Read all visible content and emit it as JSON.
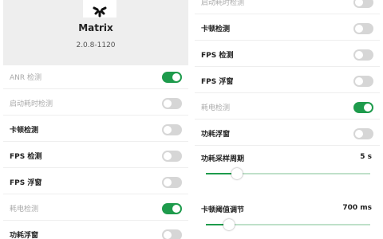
{
  "accent_color": "#1e9b4c",
  "app": {
    "name": "Matrix",
    "version": "2.0.8-1120",
    "logo_icon": "loading-spinner-icon"
  },
  "left_settings": [
    {
      "label": "ANR 检测",
      "enabled": false,
      "checked": true
    },
    {
      "label": "启动耗时检测",
      "enabled": false,
      "checked": false
    },
    {
      "label": "卡顿检测",
      "enabled": true,
      "checked": false
    },
    {
      "label": "FPS 检测",
      "enabled": true,
      "checked": false
    },
    {
      "label": "FPS 浮窗",
      "enabled": true,
      "checked": false
    },
    {
      "label": "耗电检测",
      "enabled": false,
      "checked": true
    },
    {
      "label": "功耗浮窗",
      "enabled": true,
      "checked": false
    }
  ],
  "right_settings": [
    {
      "label": "启动耗时检测",
      "enabled": false,
      "checked": false
    },
    {
      "label": "卡顿检测",
      "enabled": true,
      "checked": false
    },
    {
      "label": "FPS 检测",
      "enabled": true,
      "checked": false
    },
    {
      "label": "FPS 浮窗",
      "enabled": true,
      "checked": false
    },
    {
      "label": "耗电检测",
      "enabled": false,
      "checked": true
    },
    {
      "label": "功耗浮窗",
      "enabled": true,
      "checked": false
    }
  ],
  "sliders": [
    {
      "label": "功耗采样周期",
      "value": "5 s",
      "level": 0.19
    },
    {
      "label": "卡顿阈值调节",
      "value": "700 ms",
      "level": 0.14
    }
  ]
}
